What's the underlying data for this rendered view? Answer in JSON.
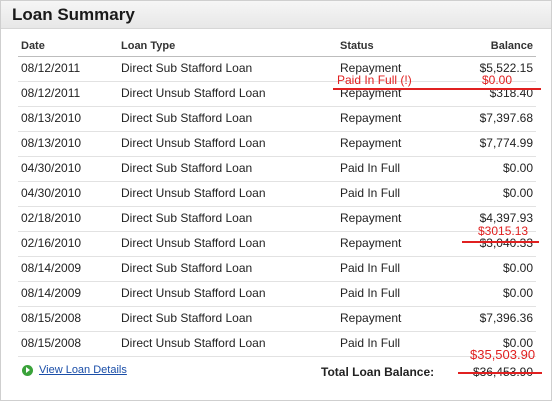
{
  "panel": {
    "title": "Loan Summary"
  },
  "table": {
    "headers": {
      "date": "Date",
      "type": "Loan Type",
      "status": "Status",
      "balance": "Balance"
    },
    "rows": [
      {
        "date": "08/12/2011",
        "type": "Direct Sub Stafford Loan",
        "status": "Repayment",
        "balance": "$5,522.15"
      },
      {
        "date": "08/12/2011",
        "type": "Direct Unsub Stafford Loan",
        "status": "Repayment",
        "balance": "$318.40"
      },
      {
        "date": "08/13/2010",
        "type": "Direct Sub Stafford Loan",
        "status": "Repayment",
        "balance": "$7,397.68"
      },
      {
        "date": "08/13/2010",
        "type": "Direct Unsub Stafford Loan",
        "status": "Repayment",
        "balance": "$7,774.99"
      },
      {
        "date": "04/30/2010",
        "type": "Direct Sub Stafford Loan",
        "status": "Paid In Full",
        "balance": "$0.00"
      },
      {
        "date": "04/30/2010",
        "type": "Direct Unsub Stafford Loan",
        "status": "Paid In Full",
        "balance": "$0.00"
      },
      {
        "date": "02/18/2010",
        "type": "Direct Sub Stafford Loan",
        "status": "Repayment",
        "balance": "$4,397.93"
      },
      {
        "date": "02/16/2010",
        "type": "Direct Unsub Stafford Loan",
        "status": "Repayment",
        "balance": "$3,040.33"
      },
      {
        "date": "08/14/2009",
        "type": "Direct Sub Stafford Loan",
        "status": "Paid In Full",
        "balance": "$0.00"
      },
      {
        "date": "08/14/2009",
        "type": "Direct Unsub Stafford Loan",
        "status": "Paid In Full",
        "balance": "$0.00"
      },
      {
        "date": "08/15/2008",
        "type": "Direct Sub Stafford Loan",
        "status": "Repayment",
        "balance": "$7,396.36"
      },
      {
        "date": "08/15/2008",
        "type": "Direct Unsub Stafford Loan",
        "status": "Paid In Full",
        "balance": "$0.00"
      }
    ]
  },
  "annotations": {
    "row2_status": "Paid In Full (!)",
    "row2_balance": "$0.00",
    "row8_balance": "$3015.13",
    "total": "$35,503.90"
  },
  "footer": {
    "link": "View Loan Details",
    "total_label": "Total Loan Balance:",
    "total_value": "$36,453.90"
  },
  "colors": {
    "annotation": "#e02020",
    "link": "#1a4ea8",
    "arrow": "#3aa23a"
  }
}
